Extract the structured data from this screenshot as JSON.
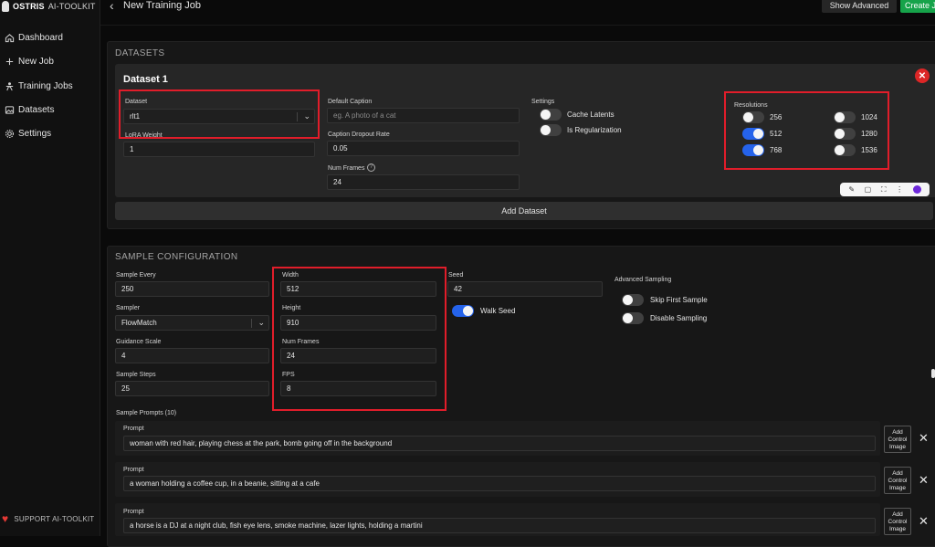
{
  "app": {
    "brand": "OSTRIS",
    "brand_suffix": "AI-TOOLKIT",
    "support": "SUPPORT AI-TOOLKIT"
  },
  "nav": [
    {
      "label": "Dashboard",
      "icon": "home-icon"
    },
    {
      "label": "New Job",
      "icon": "plus-icon"
    },
    {
      "label": "Training Jobs",
      "icon": "training-icon"
    },
    {
      "label": "Datasets",
      "icon": "images-icon"
    },
    {
      "label": "Settings",
      "icon": "gear-icon"
    }
  ],
  "header": {
    "title": "New Training Job",
    "show_advanced": "Show Advanced",
    "create": "Create J"
  },
  "datasets": {
    "section_title": "DATASETS",
    "card_title": "Dataset 1",
    "dataset_label": "Dataset",
    "dataset_value": "rlt1",
    "lora_weight_label": "LoRA Weight",
    "lora_weight_value": "1",
    "default_caption_label": "Default Caption",
    "default_caption_placeholder": "eg. A photo of a cat",
    "caption_dropout_label": "Caption Dropout Rate",
    "caption_dropout_value": "0.05",
    "num_frames_label": "Num Frames",
    "num_frames_value": "24",
    "settings_label": "Settings",
    "cache_latents": "Cache Latents",
    "is_regularization": "Is Regularization",
    "resolutions_label": "Resolutions",
    "resolutions": [
      {
        "value": "256",
        "on": false
      },
      {
        "value": "1024",
        "on": false
      },
      {
        "value": "512",
        "on": true
      },
      {
        "value": "1280",
        "on": false
      },
      {
        "value": "768",
        "on": true
      },
      {
        "value": "1536",
        "on": false
      }
    ],
    "add_dataset": "Add Dataset"
  },
  "sample": {
    "section_title": "SAMPLE CONFIGURATION",
    "sample_every_label": "Sample Every",
    "sample_every_value": "250",
    "sampler_label": "Sampler",
    "sampler_value": "FlowMatch",
    "guidance_label": "Guidance Scale",
    "guidance_value": "4",
    "steps_label": "Sample Steps",
    "steps_value": "25",
    "width_label": "Width",
    "width_value": "512",
    "height_label": "Height",
    "height_value": "910",
    "frames_label": "Num Frames",
    "frames_value": "24",
    "fps_label": "FPS",
    "fps_value": "8",
    "seed_label": "Seed",
    "seed_value": "42",
    "walk_seed": "Walk Seed",
    "advanced_label": "Advanced Sampling",
    "skip_first": "Skip First Sample",
    "disable_sampling": "Disable Sampling",
    "prompts_label": "Sample Prompts (10)",
    "prompt_label": "Prompt",
    "add_control_line1": "Add",
    "add_control_line2": "Control",
    "add_control_line3": "Image",
    "prompts": [
      "woman with red hair, playing chess at the park, bomb going off in the background",
      "a woman holding a coffee cup, in a beanie, sitting at a cafe",
      "a horse is a DJ at a night club, fish eye lens, smoke machine, lazer lights, holding a martini"
    ]
  },
  "colors": {
    "accent_blue": "#2563eb",
    "create_green": "#16a34a",
    "highlight_red": "#e11d2a"
  }
}
